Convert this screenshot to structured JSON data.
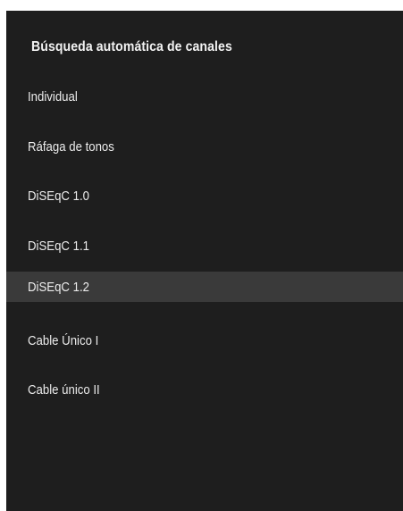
{
  "dialog": {
    "title": "Búsqueda automática de canales",
    "selected_index": 4,
    "options": [
      {
        "label": "Individual"
      },
      {
        "label": "Ráfaga de tonos"
      },
      {
        "label": "DiSEqC 1.0"
      },
      {
        "label": "DiSEqC 1.1"
      },
      {
        "label": "DiSEqC 1.2"
      },
      {
        "label": "Cable Único I"
      },
      {
        "label": "Cable único II"
      }
    ]
  },
  "colors": {
    "panel_background": "#1e1e1e",
    "selected_row": "#3a3a3a",
    "text": "#ececec"
  }
}
